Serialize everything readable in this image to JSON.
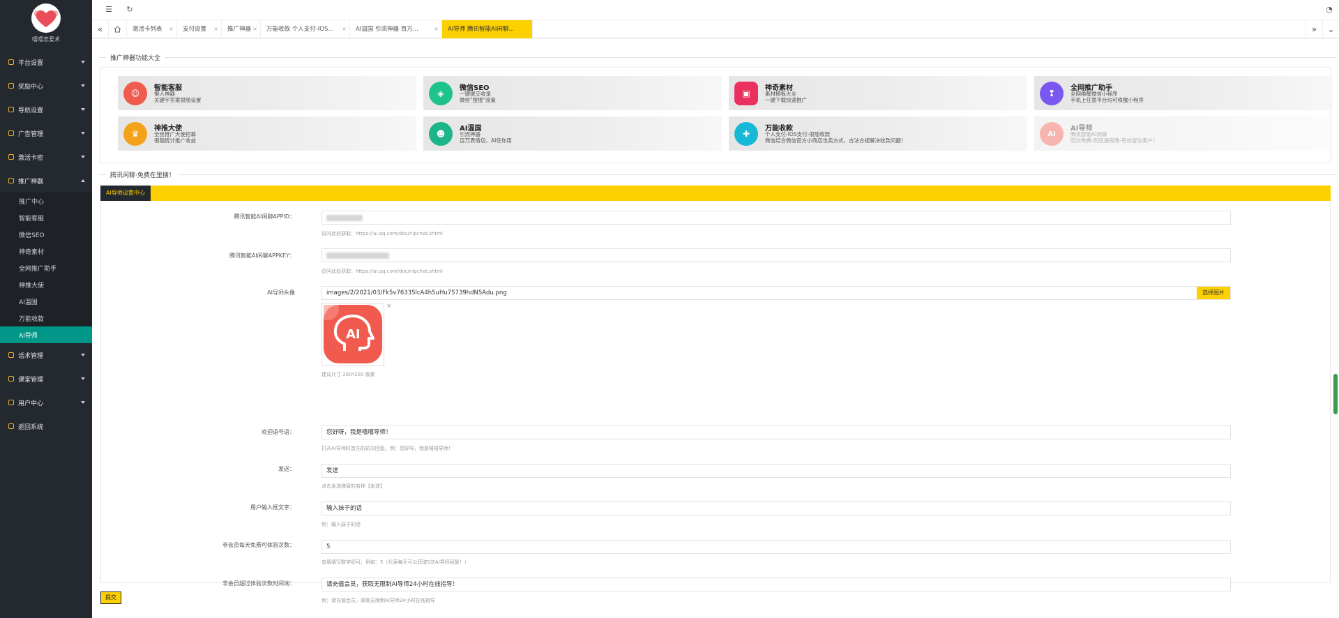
{
  "sidebar": {
    "logo_text": "嘻嘻恋爱术",
    "menu": [
      {
        "label": "平台设置"
      },
      {
        "label": "奖励中心"
      },
      {
        "label": "导航设置"
      },
      {
        "label": "广告管理"
      },
      {
        "label": "激活卡密"
      },
      {
        "label": "推广神器"
      }
    ],
    "submenu": [
      {
        "label": "推广中心"
      },
      {
        "label": "智能客服"
      },
      {
        "label": "微信SEO"
      },
      {
        "label": "神奇素材"
      },
      {
        "label": "全网推广助手"
      },
      {
        "label": "神推大使"
      },
      {
        "label": "AI温国"
      },
      {
        "label": "万能收款"
      },
      {
        "label": "AI导师"
      }
    ],
    "menu_after": [
      {
        "label": "话术管理"
      },
      {
        "label": "课堂管理"
      },
      {
        "label": "用户中心"
      },
      {
        "label": "返回系统"
      }
    ]
  },
  "topbar": {
    "menu_icon": "menu-toggle-icon",
    "refresh_icon": "refresh-icon",
    "theme_icon": "palette-icon"
  },
  "tabs": [
    {
      "label": "激活卡列表"
    },
    {
      "label": "支付设置"
    },
    {
      "label": "推广神器"
    },
    {
      "label": "万能收款 个人支付-IOS..."
    },
    {
      "label": "AI温国 引流神器 百万..."
    },
    {
      "label": "AI导师 腾讯智能AI闲聊..."
    }
  ],
  "section1_title": "推广神器功能大全",
  "features": [
    {
      "title": "智能客服",
      "sub": "懒人神器",
      "desc": "关键字答案很随设置",
      "color": "#f05a4f",
      "icon": "robot-icon",
      "glyph": "☺"
    },
    {
      "title": "微信SEO",
      "sub": "一键提交收录",
      "desc": "微信\"搜搜\"流量",
      "color": "#1ec28b",
      "icon": "tag-icon",
      "glyph": "◈"
    },
    {
      "title": "神奇素材",
      "sub": "素材模板大全",
      "desc": "一键下载快速推广",
      "color": "#e9305f",
      "icon": "gallery-icon",
      "glyph": "▣"
    },
    {
      "title": "全网推广助手",
      "sub": "全网唤醒微信小程序",
      "desc": "手机上任意平台均可唤醒小程序",
      "color": "#7a57f0",
      "icon": "bulb-icon",
      "glyph": "❢"
    },
    {
      "title": "神推大使",
      "sub": "全民推广大使招募",
      "desc": "很随统计推广收益",
      "color": "#f5a21b",
      "icon": "trophy-icon",
      "glyph": "♛"
    },
    {
      "title": "AI温国",
      "sub": "引流神器",
      "desc": "百万表情包、AI任你用",
      "color": "#1cb58a",
      "icon": "smile-icon",
      "glyph": "☻"
    },
    {
      "title": "万能收款",
      "sub": "个人支付-IOS支付-很随收款",
      "desc": "微信结合微信官方小商店也卖方式，合法合规解决收款问题！",
      "color": "#16b8d6",
      "icon": "shield-icon",
      "glyph": "✚"
    },
    {
      "title": "AI导师",
      "sub": "腾讯智能AI闲聊",
      "desc": "陪你免费-明任遇夜晚-有效留住客户！",
      "color": "#f05a4f",
      "icon": "ai-head-icon",
      "glyph": "AI"
    }
  ],
  "section2_title": "腾讯闲聊·免费在里搜！",
  "settings_tab": "AI导师设置中心",
  "form": {
    "appid_label": "腾讯智能AI闲聊APPID：",
    "appid_help": "访问此处获取：https://ai.qq.com/doc/nlpchat.shtml",
    "appkey_label": "腾讯智能AI闲聊APPKEY：",
    "appkey_help": "访问此处获取：https://ai.qq.com/doc/nlpchat.shtml",
    "avatar_label": "AI导师头像",
    "avatar_value": "images/2/2021/03/Fk5v76335lcA4h5uHu75739hdN5Adu.png",
    "avatar_button": "选择图片",
    "avatar_close": "×",
    "avatar_help": "建议尺寸 200*200 像素",
    "welcome_label": "欢迎语号语：",
    "welcome_value": "您好呀，我是嘻嘻导师！",
    "welcome_help": "打开AI导师时首先的初次回复。例：您好呀，我是嘻嘻导师！",
    "send_label": "发送：",
    "send_value": "发送",
    "send_help": "点击发送弹窗的名称【发送】",
    "input_label": "用户输入框文字：",
    "input_value": "输入妹子的话",
    "input_help": "例：输入妹子的话",
    "count_label": "非会员每天免费可体验次数：",
    "count_value": "5",
    "count_help": "血填填写数字即可。例如：5（代表每天可以获取5次AI导师回复！）",
    "limit_label": "非会员超过体验次数时间询：",
    "limit_value": "请充值会员，获取无限制AI导师24小时在线指导！",
    "limit_help": "例：请充值会员，获取无限制AI导师24小时在线指导"
  },
  "submit_label": "提交"
}
